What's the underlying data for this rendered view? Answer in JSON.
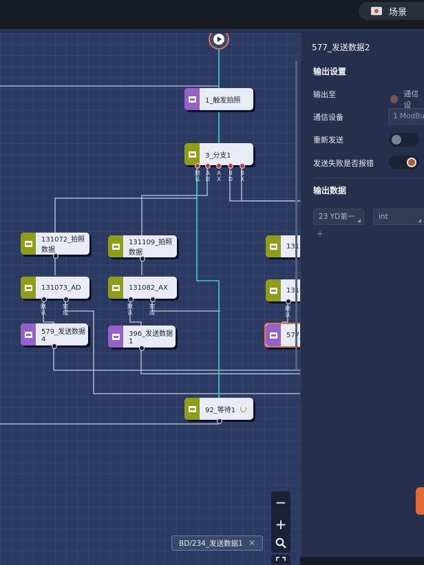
{
  "header": {
    "scene_label": "场景"
  },
  "canvas": {
    "nodes": [
      {
        "label": "1_触发拍照"
      },
      {
        "label": "3_分支1"
      },
      {
        "label": "131072_拍照数据"
      },
      {
        "label": "131109_拍照数据"
      },
      {
        "label": "131"
      },
      {
        "label": "131073_AD"
      },
      {
        "label": "131082_AX"
      },
      {
        "label": "1310"
      },
      {
        "label": "579_发送数据4"
      },
      {
        "label": "396_发送数据1"
      },
      {
        "label": "577_"
      },
      {
        "label": "92_等待1"
      }
    ],
    "branch_ports": [
      "默认",
      "AD",
      "AX",
      "BD",
      "BX"
    ],
    "ad_ports": [
      "默认",
      "完成"
    ],
    "ax_ports": [
      "默认",
      "完成"
    ],
    "right_ports": [
      "默认"
    ]
  },
  "search_tag": {
    "label": "BD/234_发送数据1"
  },
  "panel": {
    "title": "577_发送数据2",
    "output_settings": {
      "heading": "输出设置",
      "output_to_label": "输出至",
      "output_to_option": "通信设",
      "device_label": "通信设备",
      "device_value": "1 ModBu",
      "resend_label": "重新发送",
      "resend_on": false,
      "error_label": "发送失败是否报错",
      "error_on": true
    },
    "output_data": {
      "heading": "输出数据",
      "field_name": "23 YD第一",
      "field_type": "int"
    }
  },
  "colors": {
    "accent": "#e07a3f",
    "wire_active": "#36d3c4",
    "purple": "#9660c9",
    "olive": "#8f9d17"
  }
}
